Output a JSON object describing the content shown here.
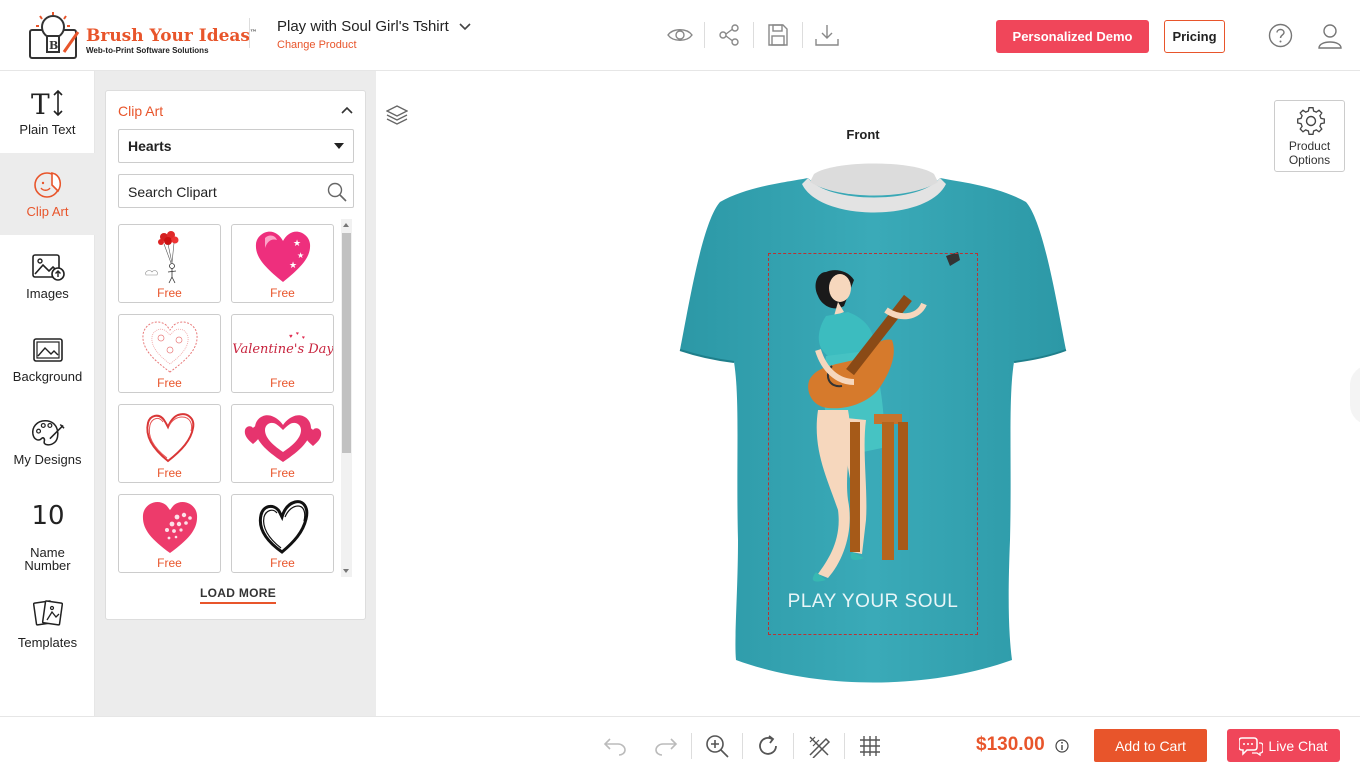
{
  "brand": {
    "name": "Brush Your Ideas",
    "trademark": "™",
    "tagline": "Web-to-Print Software Solutions",
    "accent_color": "#e8552b"
  },
  "header": {
    "product_title": "Play with Soul Girl's Tshirt",
    "change_product": "Change Product",
    "tools": [
      "preview-icon",
      "share-icon",
      "save-icon",
      "download-icon"
    ],
    "personalized_demo": "Personalized Demo",
    "pricing": "Pricing",
    "demo_color": "#f0465a"
  },
  "sidebar": {
    "items": [
      {
        "label": "Plain Text",
        "icon": "text-icon"
      },
      {
        "label": "Clip Art",
        "icon": "clipart-icon",
        "active": true
      },
      {
        "label": "Images",
        "icon": "image-upload-icon"
      },
      {
        "label": "Background",
        "icon": "background-icon"
      },
      {
        "label": "My Designs",
        "icon": "palette-icon"
      },
      {
        "label": "Name",
        "label2": "Number",
        "icon_text": "10",
        "icon": "name-number-icon"
      },
      {
        "label": "Templates",
        "icon": "templates-icon"
      }
    ]
  },
  "clipart_panel": {
    "title": "Clip Art",
    "category": "Hearts",
    "search_placeholder": "Search Clipart",
    "items": [
      {
        "price": "Free",
        "art": "balloon-figure"
      },
      {
        "price": "Free",
        "art": "pink-heart-stars"
      },
      {
        "price": "Free",
        "art": "floral-heart-outline"
      },
      {
        "price": "Free",
        "art": "valentines-day-script",
        "art_text": "Valentine's Day"
      },
      {
        "price": "Free",
        "art": "sketch-red-heart"
      },
      {
        "price": "Free",
        "art": "double-pink-heart"
      },
      {
        "price": "Free",
        "art": "halftone-pink-heart"
      },
      {
        "price": "Free",
        "art": "brush-black-heart"
      }
    ],
    "load_more": "LOAD MORE"
  },
  "canvas": {
    "side": "Front",
    "product_options_line1": "Product",
    "product_options_line2": "Options",
    "print_text": "PLAY YOUR SOUL",
    "shirt_color": "#34a4b2"
  },
  "footer": {
    "tools": [
      "undo-icon",
      "redo-icon",
      "zoom-in-icon",
      "reset-icon",
      "edit-tools-icon",
      "grid-icon"
    ],
    "price": "$130.00",
    "add_to_cart": "Add to Cart",
    "live_chat": "Live Chat"
  }
}
